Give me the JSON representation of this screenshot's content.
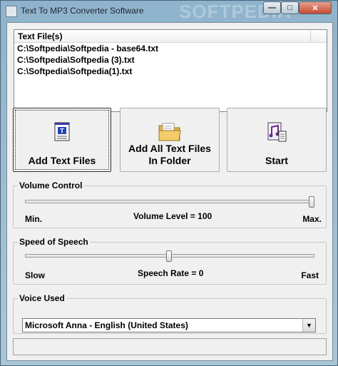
{
  "window": {
    "title": "Text To MP3 Converter Software",
    "watermark": "SOFTPEDIA",
    "controls": {
      "minimize": "—",
      "maximize": "□",
      "close": "✕"
    }
  },
  "file_list": {
    "header": "Text File(s)",
    "files": [
      "C:\\Softpedia\\Softpedia - base64.txt",
      "C:\\Softpedia\\Softpedia (3).txt",
      "C:\\Softpedia\\Softpedia(1).txt"
    ]
  },
  "buttons": {
    "add_files": {
      "label": "Add Text Files",
      "icon": "text-document-icon"
    },
    "add_folder": {
      "label_line1": "Add All Text Files",
      "label_line2": "In Folder",
      "icon": "folder-icon"
    },
    "start": {
      "label": "Start",
      "icon": "music-document-icon"
    }
  },
  "volume": {
    "group_label": "Volume Control",
    "min_label": "Min.",
    "max_label": "Max.",
    "level_text": "Volume Level = 100",
    "value": 100
  },
  "speech": {
    "group_label": "Speed of Speech",
    "slow_label": "Slow",
    "fast_label": "Fast",
    "rate_text": "Speech Rate = 0",
    "value_fraction": 0.5
  },
  "voice": {
    "group_label": "Voice Used",
    "selected": "Microsoft Anna - English (United States)"
  },
  "status": {
    "text": ""
  }
}
